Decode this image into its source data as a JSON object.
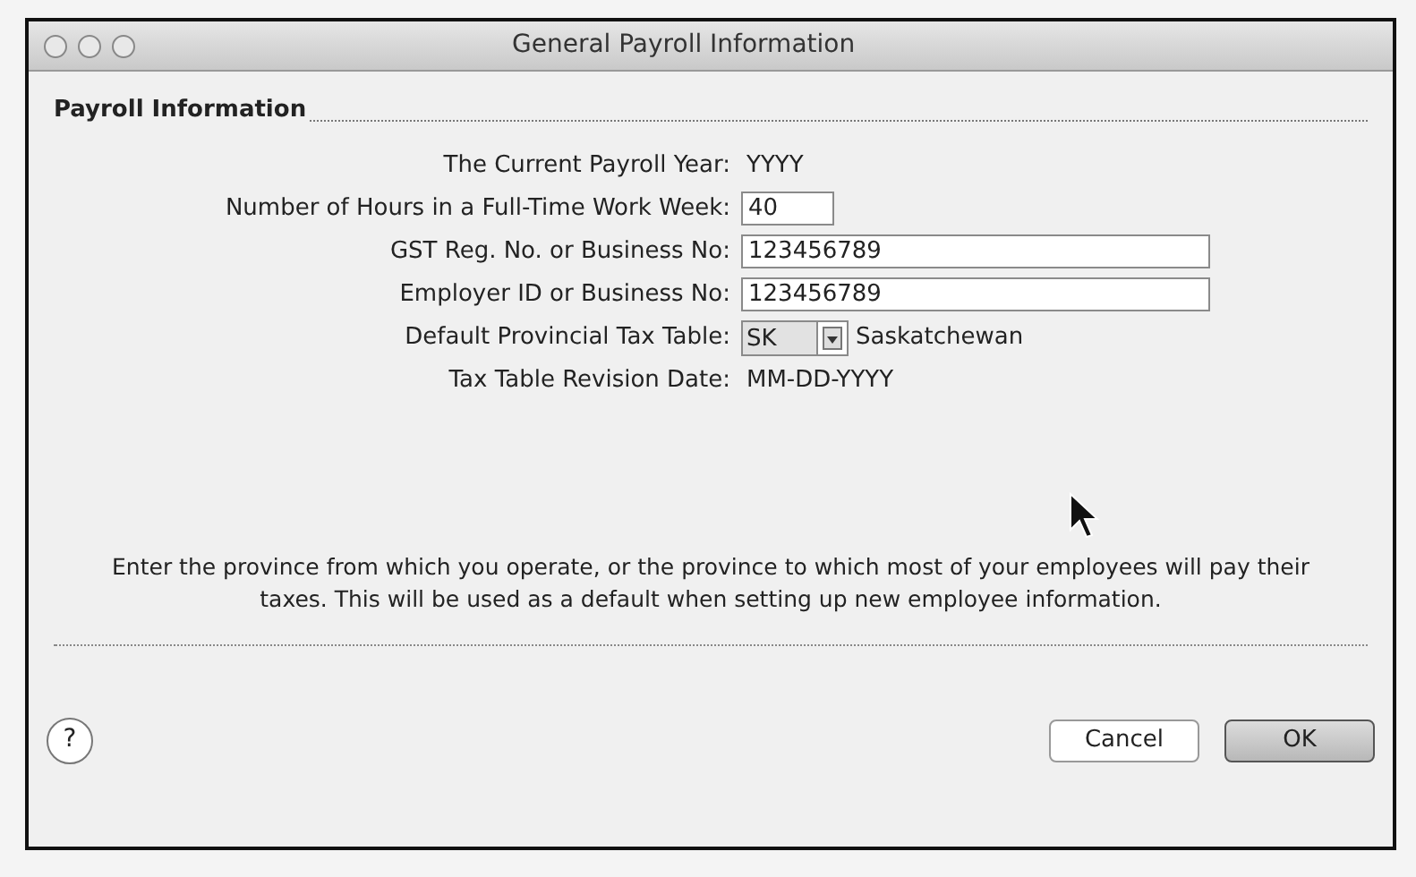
{
  "window": {
    "title": "General Payroll Information"
  },
  "section": {
    "title": "Payroll Information"
  },
  "fields": [
    {
      "kind": "text",
      "label": "The Current Payroll Year:",
      "value": "YYYY"
    },
    {
      "kind": "short-input",
      "label": "Number of Hours in a Full-Time Work Week:",
      "value": "40"
    },
    {
      "kind": "input",
      "label": "GST Reg. No. or Business No:",
      "value": "123456789"
    },
    {
      "kind": "input",
      "label": "Employer ID or Business No:",
      "value": "123456789"
    },
    {
      "kind": "select",
      "label": "Default Provincial Tax Table:",
      "value": "SK",
      "caption": "Saskatchewan"
    },
    {
      "kind": "text",
      "label": "Tax Table Revision Date:",
      "value": "MM-DD-YYYY"
    }
  ],
  "hint": "Enter the province from which you operate, or the province to which most of your employees will pay their taxes.  This will be used as a default when setting up new employee information.",
  "help": "?",
  "buttons": [
    {
      "label": "Cancel",
      "default": false
    },
    {
      "label": "OK",
      "default": true
    }
  ]
}
